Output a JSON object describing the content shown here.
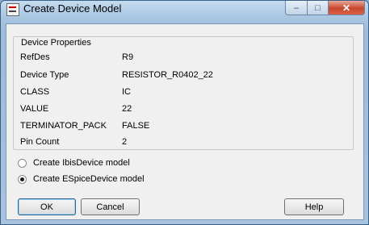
{
  "window": {
    "title": "Create Device Model"
  },
  "group": {
    "title": "Device Properties",
    "rows": [
      {
        "key": "RefDes",
        "value": "R9"
      },
      {
        "key": "Device Type",
        "value": "RESISTOR_R0402_22"
      },
      {
        "key": "CLASS",
        "value": "IC"
      },
      {
        "key": "VALUE",
        "value": "22"
      },
      {
        "key": "TERMINATOR_PACK",
        "value": "FALSE"
      },
      {
        "key": "Pin Count",
        "value": "2"
      }
    ]
  },
  "options": [
    {
      "label": "Create IbisDevice model",
      "selected": false
    },
    {
      "label": "Create ESpiceDevice model",
      "selected": true
    }
  ],
  "buttons": {
    "ok": "OK",
    "cancel": "Cancel",
    "help": "Help"
  },
  "caption_buttons": {
    "minimize": "–",
    "maximize": "□",
    "close": "✕"
  }
}
